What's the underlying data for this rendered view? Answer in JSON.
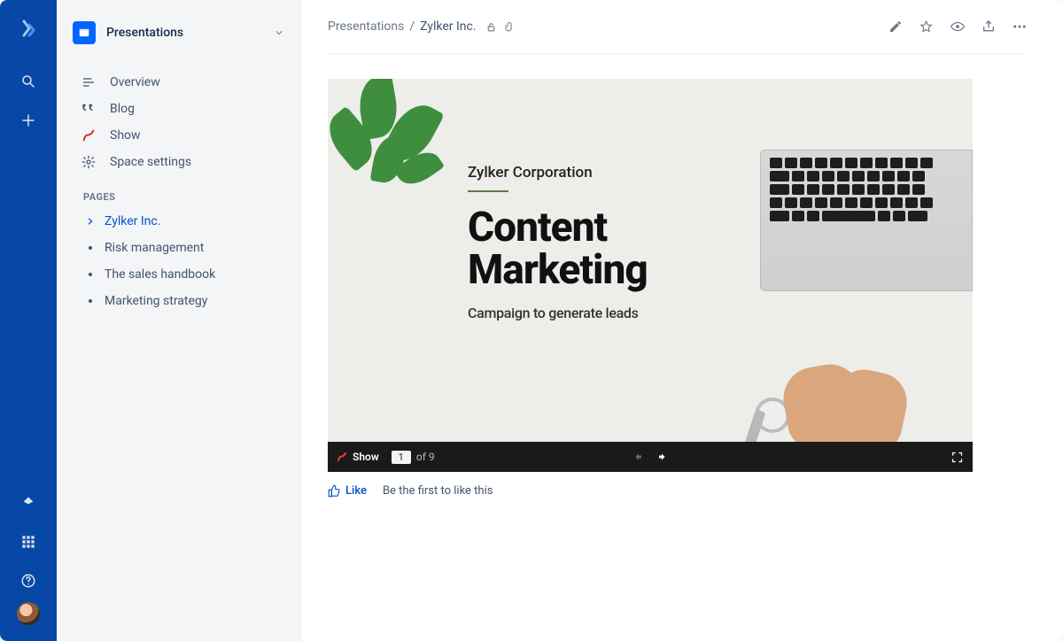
{
  "space": {
    "name": "Presentations"
  },
  "nav": {
    "overview": "Overview",
    "blog": "Blog",
    "show": "Show",
    "settings": "Space settings"
  },
  "pages_header": "PAGES",
  "pages": [
    {
      "label": "Zylker Inc.",
      "active": true
    },
    {
      "label": "Risk management",
      "active": false
    },
    {
      "label": "The sales handbook",
      "active": false
    },
    {
      "label": "Marketing strategy",
      "active": false
    }
  ],
  "breadcrumb": {
    "root": "Presentations",
    "current": "Zylker Inc."
  },
  "slide": {
    "company": "Zylker Corporation",
    "title_l1": "Content",
    "title_l2": "Marketing",
    "subtitle": "Campaign to generate leads"
  },
  "player": {
    "brand": "Show",
    "page": "1",
    "of_label": "of",
    "total": "9"
  },
  "like": {
    "button": "Like",
    "hint": "Be the first to like this"
  }
}
